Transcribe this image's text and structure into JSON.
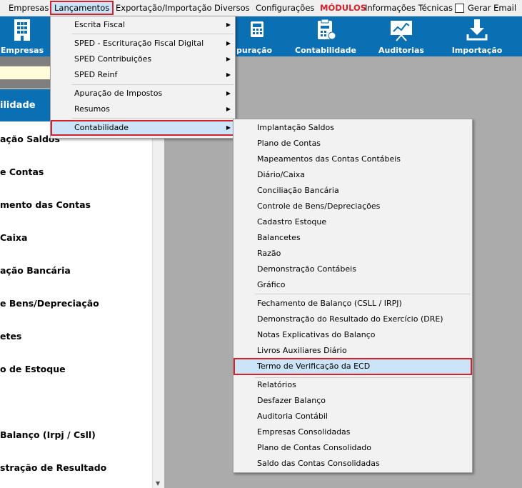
{
  "menubar": {
    "items": [
      "Empresas",
      "Lançamentos",
      "Exportação/Importação",
      "Diversos",
      "Configurações",
      "MÓDULOS",
      "Informações Técnicas"
    ],
    "gerar_email": "Gerar Email"
  },
  "toolbar": {
    "empresas": "Empresas",
    "apuracao": "puração",
    "contabilidade": "Contabilidade",
    "auditorias": "Auditorias",
    "importacao": "Importação"
  },
  "left": {
    "header": "ilidade",
    "items": [
      "ação Saldos",
      "e Contas",
      "mento das Contas",
      "Caixa",
      "ação Bancária",
      "e Bens/Depreciação",
      "etes",
      "o de Estoque",
      "Balanço (Irpj / Csll)",
      "stração de Resultado"
    ]
  },
  "menu1": {
    "items": [
      "Escrita Fiscal",
      "SPED - Escrituração Fiscal Digital",
      "SPED Contribuições",
      "SPED Reinf",
      "Apuração de Impostos",
      "Resumos",
      "Contabilidade"
    ]
  },
  "menu2": {
    "items": [
      "Implantação Saldos",
      "Plano de Contas",
      "Mapeamentos das Contas Contábeis",
      "Diário/Caixa",
      "Conciliação Bancária",
      "Controle de Bens/Depreciações",
      "Cadastro Estoque",
      "Balancetes",
      "Razão",
      "Demonstração Contábeis",
      "Gráfico",
      "Fechamento de Balanço (CSLL / IRPJ)",
      "Demonstração do Resultado do Exercício (DRE)",
      "Notas Explicativas do Balanço",
      "Livros Auxiliares Diário",
      "Termo de Verificação da ECD",
      "Relatórios",
      "Desfazer Balanço",
      "Auditoria Contábil",
      "Empresas Consolidadas",
      "Plano de Contas Consolidado",
      "Saldo das Contas Consolidadas"
    ]
  },
  "colors": {
    "toolbar": "#0b6fb3",
    "highlight_border": "#d4212b",
    "highlight_fill": "#cce4f7"
  }
}
